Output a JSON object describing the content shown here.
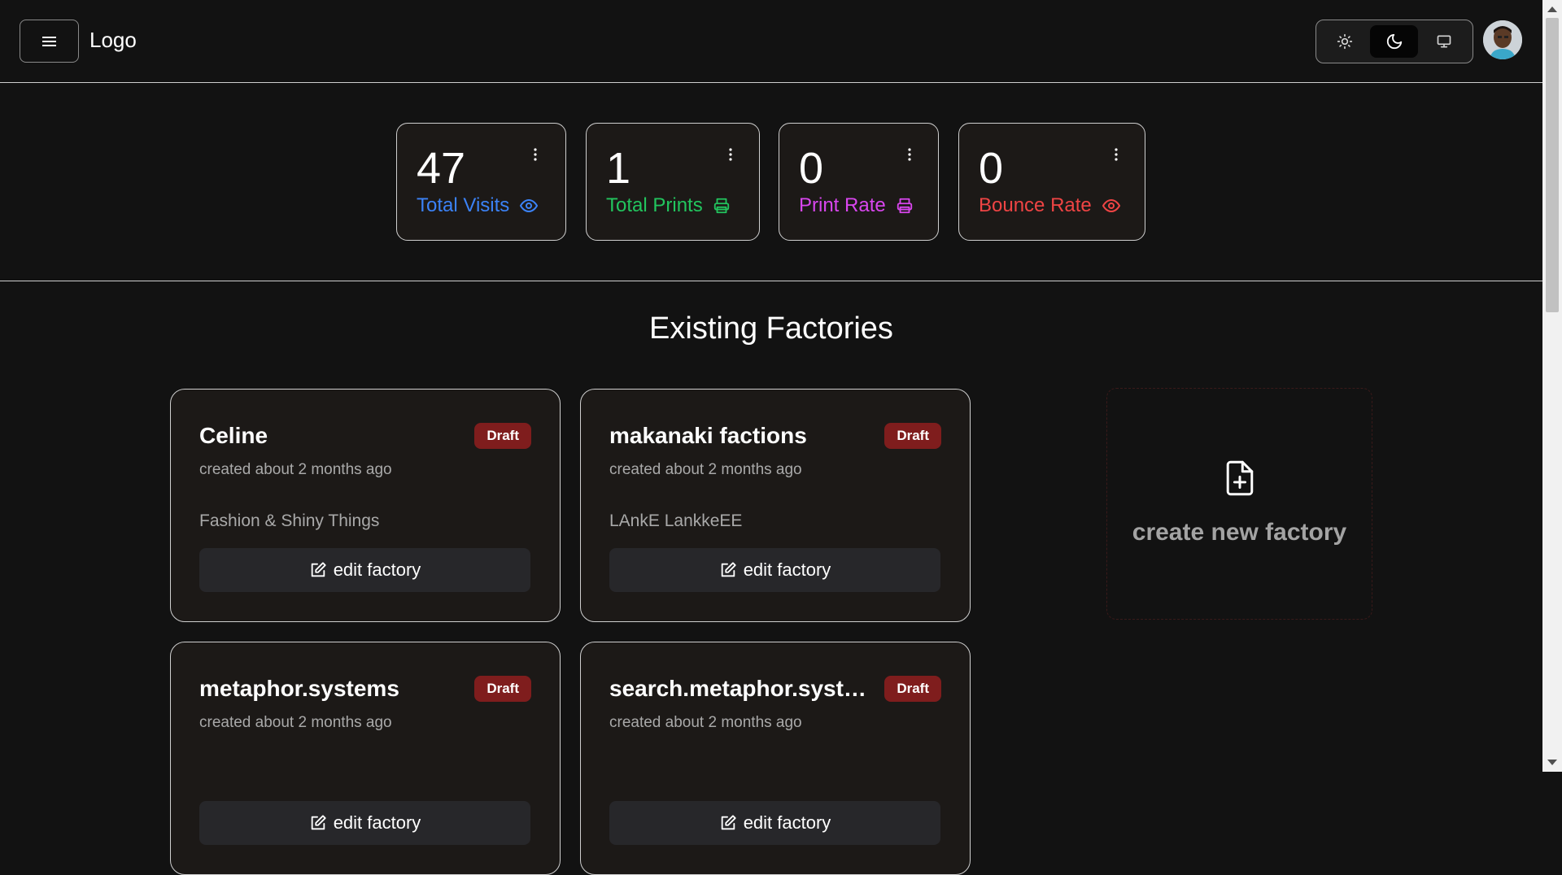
{
  "header": {
    "logo": "Logo",
    "menu_icon": "hamburger-menu-icon",
    "theme_options": [
      {
        "name": "light",
        "icon": "sun-icon",
        "active": false
      },
      {
        "name": "dark",
        "icon": "moon-icon",
        "active": true
      },
      {
        "name": "system",
        "icon": "monitor-icon",
        "active": false
      }
    ],
    "avatar_icon": "user-avatar"
  },
  "stats": [
    {
      "value": "47",
      "label": "Total Visits",
      "icon": "eye-icon",
      "color": "#3b82f6"
    },
    {
      "value": "1",
      "label": "Total Prints",
      "icon": "printer-icon",
      "color": "#22c55e"
    },
    {
      "value": "0",
      "label": "Print Rate",
      "icon": "printer-icon",
      "color": "#d946ef"
    },
    {
      "value": "0",
      "label": "Bounce Rate",
      "icon": "eye-icon",
      "color": "#ef4444"
    }
  ],
  "section": {
    "title": "Existing Factories"
  },
  "factories": [
    {
      "name": "Celine",
      "status": "Draft",
      "created": "created about 2 months ago",
      "description": "Fashion & Shiny Things",
      "edit_label": "edit factory"
    },
    {
      "name": "makanaki factions",
      "status": "Draft",
      "created": "created about 2 months ago",
      "description": "LAnkE LankkeEE",
      "edit_label": "edit factory"
    },
    {
      "name": "metaphor.systems",
      "status": "Draft",
      "created": "created about 2 months ago",
      "description": "",
      "edit_label": "edit factory"
    },
    {
      "name": "search.metaphor.systems",
      "status": "Draft",
      "created": "created about 2 months ago",
      "description": "",
      "edit_label": "edit factory"
    }
  ],
  "create": {
    "label": "create new factory",
    "icon": "file-plus-icon"
  },
  "colors": {
    "badge": "#7f1d1d",
    "background": "#121212",
    "card": "#1c1917"
  }
}
